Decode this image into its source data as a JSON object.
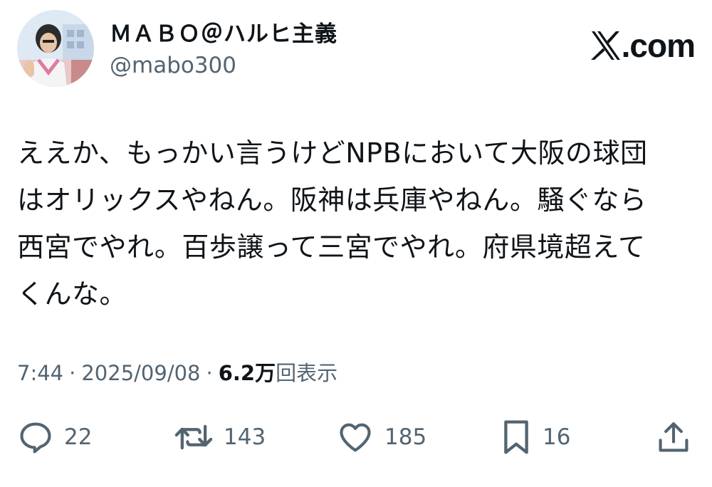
{
  "author": {
    "display_name": "ＭＡＢＯ＠ハルヒ主義",
    "handle": "@mabo300",
    "avatar_icon": "user-photo-avatar"
  },
  "source": {
    "logo_icon": "x-logo-icon",
    "logo_text": ".com"
  },
  "tweet": {
    "text": "ええか、もっかい言うけどNPBにおいて大阪の球団\nはオリックスやねん。阪神は兵庫やねん。騒ぐなら\n西宮でやれ。百歩譲って三宮でやれ。府県境超えて\nくんな。"
  },
  "meta": {
    "time": "7:44",
    "separator": "·",
    "date": "2025/09/08",
    "views_count": "6.2万",
    "views_label": "回表示"
  },
  "actions": {
    "reply": {
      "icon": "reply-icon",
      "count": "22"
    },
    "retweet": {
      "icon": "retweet-icon",
      "count": "143"
    },
    "like": {
      "icon": "heart-icon",
      "count": "185"
    },
    "bookmark": {
      "icon": "bookmark-icon",
      "count": "16"
    },
    "share": {
      "icon": "share-icon"
    }
  },
  "colors": {
    "text_primary": "#0f1419",
    "text_secondary": "#536471",
    "icon": "#536471",
    "background": "#ffffff"
  }
}
